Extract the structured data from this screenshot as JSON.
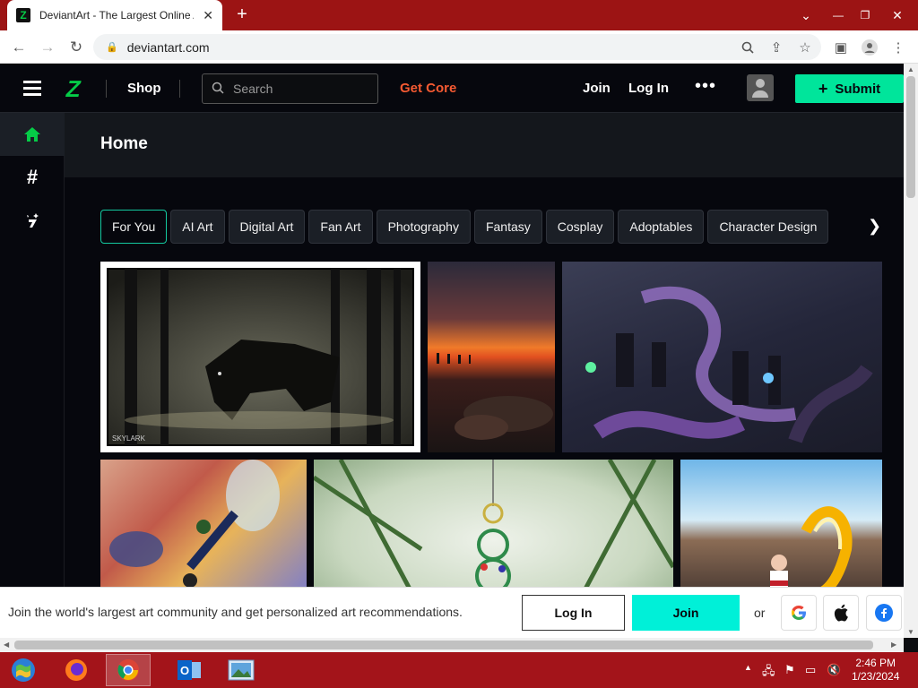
{
  "browser": {
    "tab_title": "DeviantArt - The Largest Online Art Gallery and Community",
    "url": "deviantart.com",
    "minimize": "⌄",
    "close": "✕"
  },
  "topbar": {
    "shop": "Shop",
    "search_placeholder": "Search",
    "get_core": "Get Core",
    "join": "Join",
    "login": "Log In",
    "more": "•••",
    "submit": "Submit"
  },
  "page": {
    "title": "Home"
  },
  "chips": [
    "For You",
    "AI Art",
    "Digital Art",
    "Fan Art",
    "Photography",
    "Fantasy",
    "Cosplay",
    "Adoptables",
    "Character Design"
  ],
  "gallery": {
    "tile1_signature": "SKYLARK"
  },
  "promo": {
    "text": "Join the world's largest art community and get personalized art recommendations.",
    "login": "Log In",
    "join": "Join",
    "or": "or"
  },
  "taskbar": {
    "time": "2:46 PM",
    "date": "1/23/2024"
  },
  "colors": {
    "brand_green": "#05cc47",
    "submit_green": "#00e59b",
    "join_cyan": "#00f0d8",
    "get_core_orange": "#f55a32",
    "taskbar_red": "#a3141a"
  }
}
